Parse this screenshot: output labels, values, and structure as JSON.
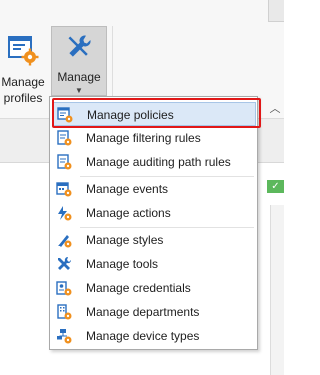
{
  "ribbon": {
    "buttons": [
      {
        "id": "manage_profiles",
        "label_line1": "Manage",
        "label_line2": "profiles",
        "icon": "profile-settings-icon"
      },
      {
        "id": "manage",
        "label": "Manage",
        "icon": "wrench-screwdriver-icon",
        "caret": "▼"
      }
    ],
    "collapse_glyph": "︿"
  },
  "status": {
    "check_glyph": "✓"
  },
  "menu": {
    "items": [
      {
        "label": "Manage policies",
        "icon": "policies-icon",
        "selected": true
      },
      {
        "label": "Manage filtering rules",
        "icon": "filtering-rules-icon"
      },
      {
        "label": "Manage auditing path rules",
        "icon": "auditing-path-rules-icon"
      },
      {
        "label": "Manage events",
        "icon": "events-icon"
      },
      {
        "label": "Manage actions",
        "icon": "actions-icon"
      },
      {
        "label": "Manage styles",
        "icon": "styles-icon"
      },
      {
        "label": "Manage tools",
        "icon": "tools-icon"
      },
      {
        "label": "Manage credentials",
        "icon": "credentials-icon"
      },
      {
        "label": "Manage departments",
        "icon": "departments-icon"
      },
      {
        "label": "Manage device types",
        "icon": "device-types-icon"
      }
    ]
  },
  "colors": {
    "highlight_frame": "#e11717",
    "selected_bg": "#dbe8f7",
    "accent_orange": "#f0901e",
    "accent_blue": "#2a6fc0"
  }
}
